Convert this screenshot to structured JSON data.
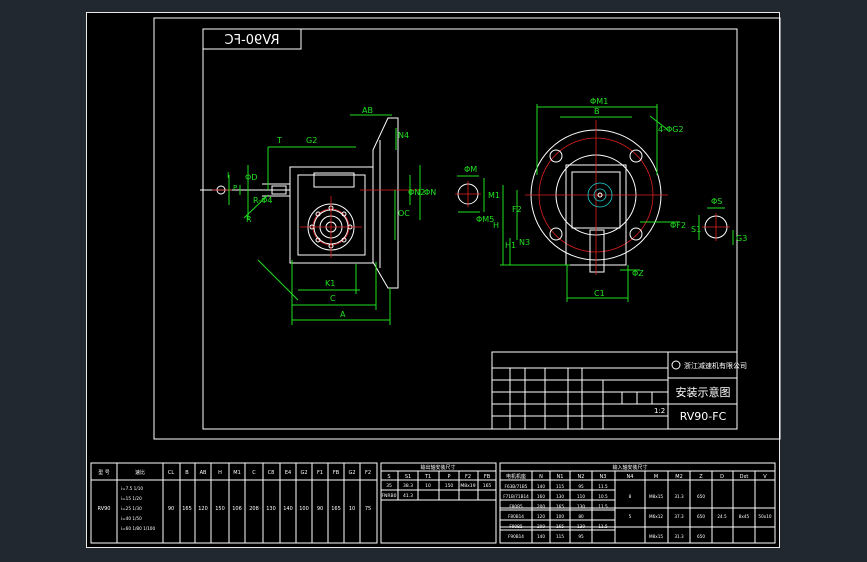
{
  "title_block": {
    "model_mirrored": "RV90-FC",
    "company": "浙江减速机有限公司",
    "drawing_name": "安装示意图",
    "model": "RV90-FC",
    "scale": "1:2"
  },
  "dims": {
    "AB": "AB",
    "T": "T",
    "G2": "G2",
    "N4": "N4",
    "I": "I",
    "P": "P",
    "phiD": "ΦD",
    "R": "R",
    "R_dash_phi4": "R-Φ4",
    "phiN2": "ΦN2",
    "phiN": "ΦN",
    "OC": "OC",
    "K1": "K1",
    "C": "C",
    "A": "A",
    "phiM": "ΦM",
    "M1": "M1",
    "phiM5": "ΦM5",
    "phiM1": "ΦM1",
    "B": "B",
    "4phiG2": "4-ΦG2",
    "F2": "F2",
    "H1": "H1",
    "H": "H",
    "N3": "N3",
    "phiF2": "ΦF2",
    "phiZ": "ΦZ",
    "C1": "C1",
    "phiS": "ΦS",
    "S1": "S1",
    "G3": "G3"
  },
  "table1": {
    "headers": [
      "型 号",
      "速比",
      "CL",
      "B",
      "AB",
      "H",
      "M1",
      "C",
      "C8",
      "E4",
      "G2",
      "F1",
      "FB",
      "G2",
      "F2"
    ],
    "row": [
      "RV90",
      "i=7.5 1/10\ni=15 1/20\ni=25 1/30\ni=40 1/50\ni=60 1/80 1/100",
      "90",
      "165",
      "120",
      "150",
      "106",
      "208",
      "130",
      "140",
      "100",
      "90",
      "165",
      "10",
      "75"
    ]
  },
  "table2": {
    "title": "输出轴安装尺寸",
    "headers": [
      "S",
      "S1",
      "T1",
      "P",
      "F2",
      "FB"
    ],
    "rows": [
      [
        "35",
        "38.3",
        "10",
        "150",
        "M8x19",
        "165"
      ],
      [
        "FNRB0",
        "41.3",
        "",
        "",
        "",
        ""
      ]
    ]
  },
  "table3": {
    "title": "输入轴安装尺寸",
    "headers": [
      "电机机座",
      "N",
      "N1",
      "N2",
      "N3",
      "N4",
      "M",
      "M2",
      "Z",
      "D",
      "Dxt",
      "V"
    ],
    "rows": [
      [
        "F63B/71B5",
        "140",
        "115",
        "95",
        "11.5",
        "",
        "",
        "",
        "",
        "",
        "",
        ""
      ],
      [
        "F71B/71B14",
        "160",
        "130",
        "110",
        "10.5",
        "8",
        "M8x15",
        "31.3",
        "650",
        "",
        "",
        ""
      ],
      [
        "F80B5",
        "200",
        "165",
        "130",
        "11.5",
        "",
        "",
        "",
        "",
        "",
        "",
        ""
      ],
      [
        "F80B14",
        "120",
        "100",
        "80",
        "",
        "5",
        "M6x12",
        "37.3",
        "650",
        "24.5",
        "8x45",
        "50x10"
      ],
      [
        "F90B5",
        "200",
        "165",
        "130",
        "11.5",
        "",
        "",
        "",
        "",
        "",
        "",
        ""
      ],
      [
        "F90B14",
        "140",
        "115",
        "95",
        "",
        "",
        "M8x15",
        "31.3",
        "650",
        "",
        "",
        ""
      ]
    ]
  }
}
